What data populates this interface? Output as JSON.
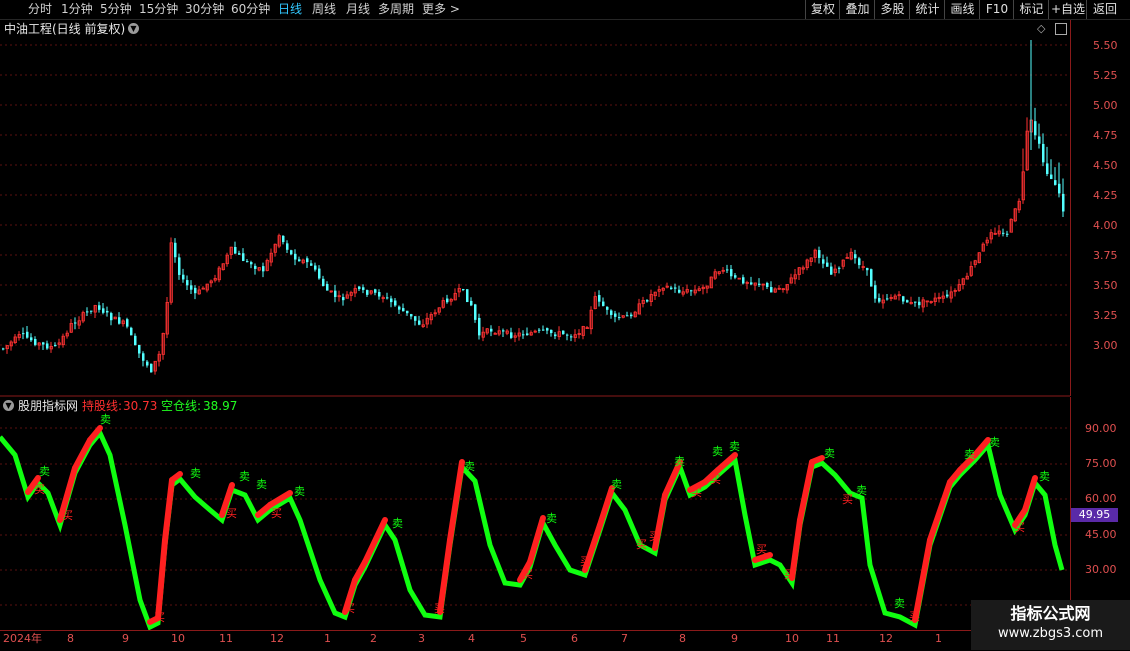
{
  "toolbar": {
    "periods": [
      "分时",
      "1分钟",
      "5分钟",
      "15分钟",
      "30分钟",
      "60分钟",
      "日线",
      "周线",
      "月线",
      "多周期",
      "更多 >"
    ],
    "active_period": "日线",
    "tools": [
      "复权",
      "叠加",
      "多股",
      "统计",
      "画线",
      "F10",
      "标记",
      "+自选",
      "返回"
    ]
  },
  "main_panel": {
    "title": "中油工程(日线 前复权)",
    "price_ticks": [
      "5.50",
      "5.25",
      "5.00",
      "4.75",
      "4.50",
      "4.25",
      "4.00",
      "3.75",
      "3.50",
      "3.25",
      "3.00"
    ]
  },
  "indicator_panel": {
    "name": "股朋指标网",
    "hold_label": "持股线:",
    "hold_value": "30.73",
    "empty_label": "空仓线:",
    "empty_value": "38.97",
    "ticks": [
      "90.00",
      "75.00",
      "60.00",
      "45.00",
      "30.00"
    ],
    "current_value": "49.95",
    "sell_marker": "卖",
    "buy_marker": "买"
  },
  "date_axis": {
    "labels": [
      "2024年",
      "8",
      "9",
      "10",
      "11",
      "12",
      "1",
      "2",
      "3",
      "4",
      "5",
      "6",
      "7",
      "8",
      "9",
      "10",
      "11",
      "12",
      "1"
    ]
  },
  "watermark": {
    "line1": "指标公式网",
    "line2": "www.zbgs3.com"
  },
  "colors": {
    "up": "#ff3232",
    "down": "#54ffff",
    "hold_line": "#ff2020",
    "empty_line": "#10ff10",
    "grid": "#5a0f0f",
    "axis_text": "#e05050",
    "active_tab": "#32c8ff"
  }
}
